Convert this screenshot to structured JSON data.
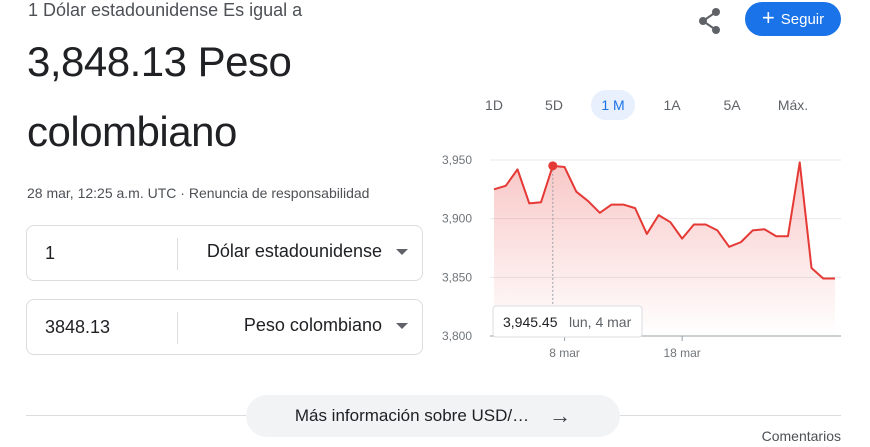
{
  "header": {
    "subtitle": "1 Dólar estadounidense Es igual a",
    "result_line1": "3,848.13 Peso",
    "result_line2": "colombiano",
    "timestamp": "28 mar, 12:25 a.m. UTC",
    "separator": "·",
    "disclaimer": "Renuncia de responsabilidad",
    "follow_label": "Seguir",
    "share_icon": "share-icon"
  },
  "converter": {
    "from": {
      "value": "1",
      "currency": "Dólar estadounidense"
    },
    "to": {
      "value": "3848.13",
      "currency": "Peso colombiano"
    }
  },
  "tabs": [
    {
      "label": "1D",
      "active": false
    },
    {
      "label": "5D",
      "active": false
    },
    {
      "label": "1 M",
      "active": true
    },
    {
      "label": "1A",
      "active": false
    },
    {
      "label": "5A",
      "active": false
    },
    {
      "label": "Máx.",
      "active": false
    }
  ],
  "tooltip": {
    "value": "3,945.45",
    "date": "lun, 4 mar"
  },
  "chart_data": {
    "type": "area",
    "y_ticks": [
      "3,950",
      "3,900",
      "3,850",
      "3,800"
    ],
    "ylim": [
      3800,
      3950
    ],
    "x_ticks": [
      {
        "label": "8 mar",
        "index": 6
      },
      {
        "label": "18 mar",
        "index": 16
      }
    ],
    "values": [
      3925,
      3928,
      3942,
      3913,
      3914,
      3945,
      3944,
      3923,
      3915,
      3905,
      3912,
      3912,
      3909,
      3887,
      3903,
      3897,
      3883,
      3895,
      3895,
      3890,
      3876,
      3880,
      3890,
      3891,
      3885,
      3885,
      3948,
      3858,
      3849,
      3849
    ],
    "highlight_index": 5,
    "line_color": "#e53935",
    "grid": true
  },
  "footer": {
    "more_label": "Más información sobre USD/…",
    "feedback": "Comentarios"
  }
}
